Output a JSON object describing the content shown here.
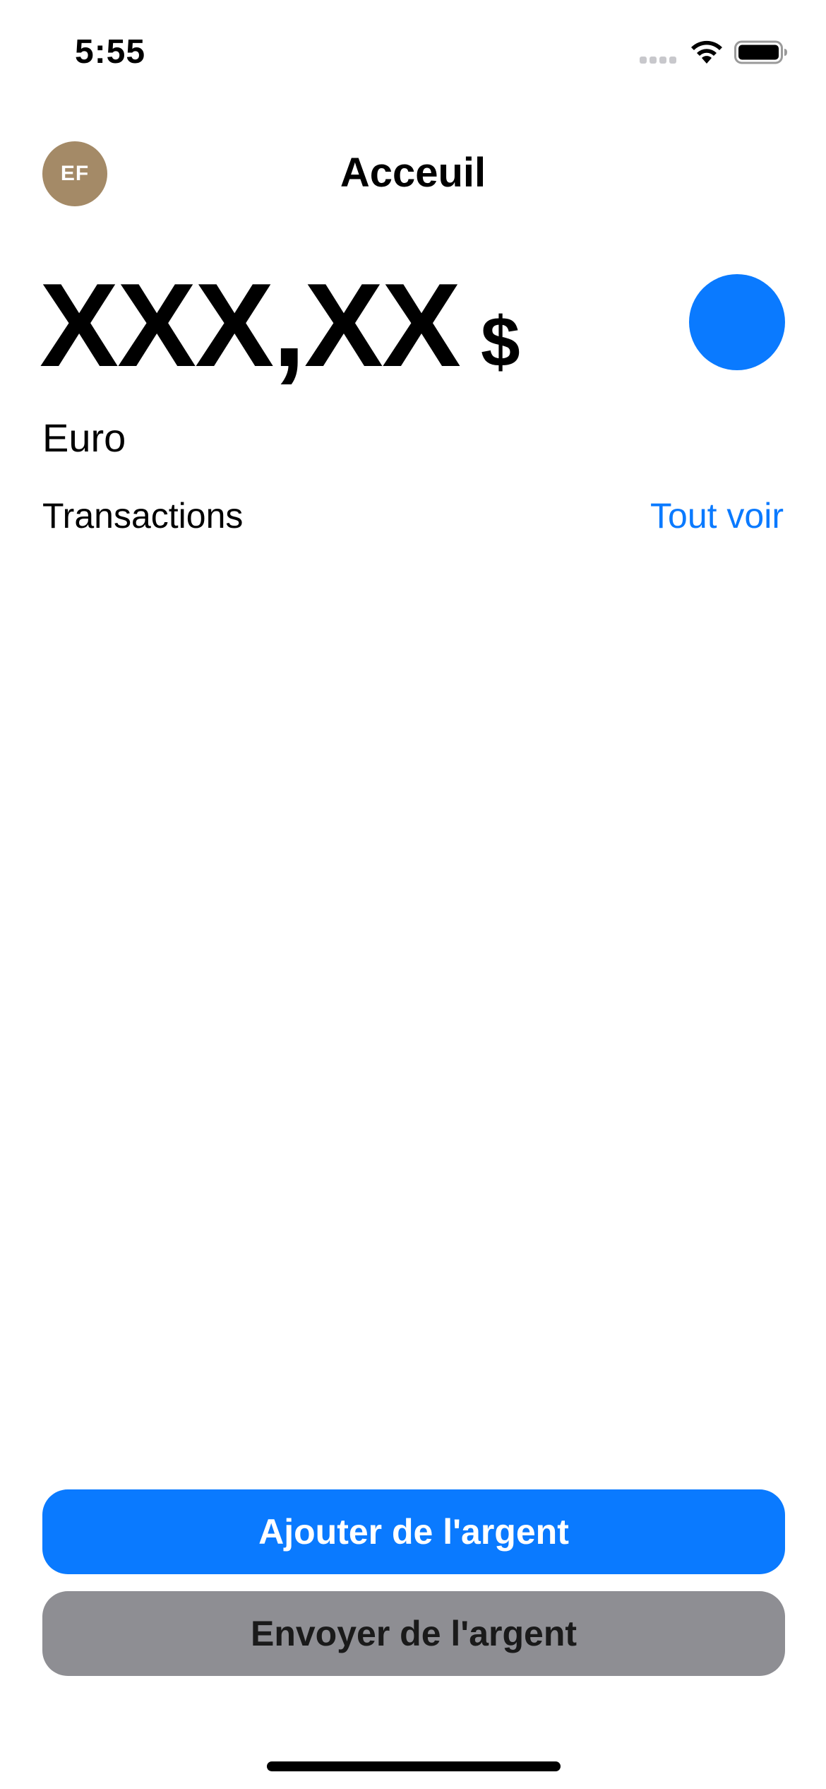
{
  "status_bar": {
    "time": "5:55",
    "icons": [
      "cellular-signal-icon",
      "wifi-icon",
      "battery-icon"
    ]
  },
  "header": {
    "avatar_initials": "EF",
    "title": "Acceuil"
  },
  "balance": {
    "amount": "XXX,XX",
    "currency_symbol": "$",
    "currency_name": "Euro"
  },
  "transactions": {
    "title": "Transactions",
    "see_all_label": "Tout voir"
  },
  "actions": {
    "add_money_label": "Ajouter de l'argent",
    "send_money_label": "Envoyer de l'argent"
  },
  "colors": {
    "accent": "#0a7aff",
    "avatar_bg": "#a48a67",
    "secondary_button": "#8e8e93"
  }
}
